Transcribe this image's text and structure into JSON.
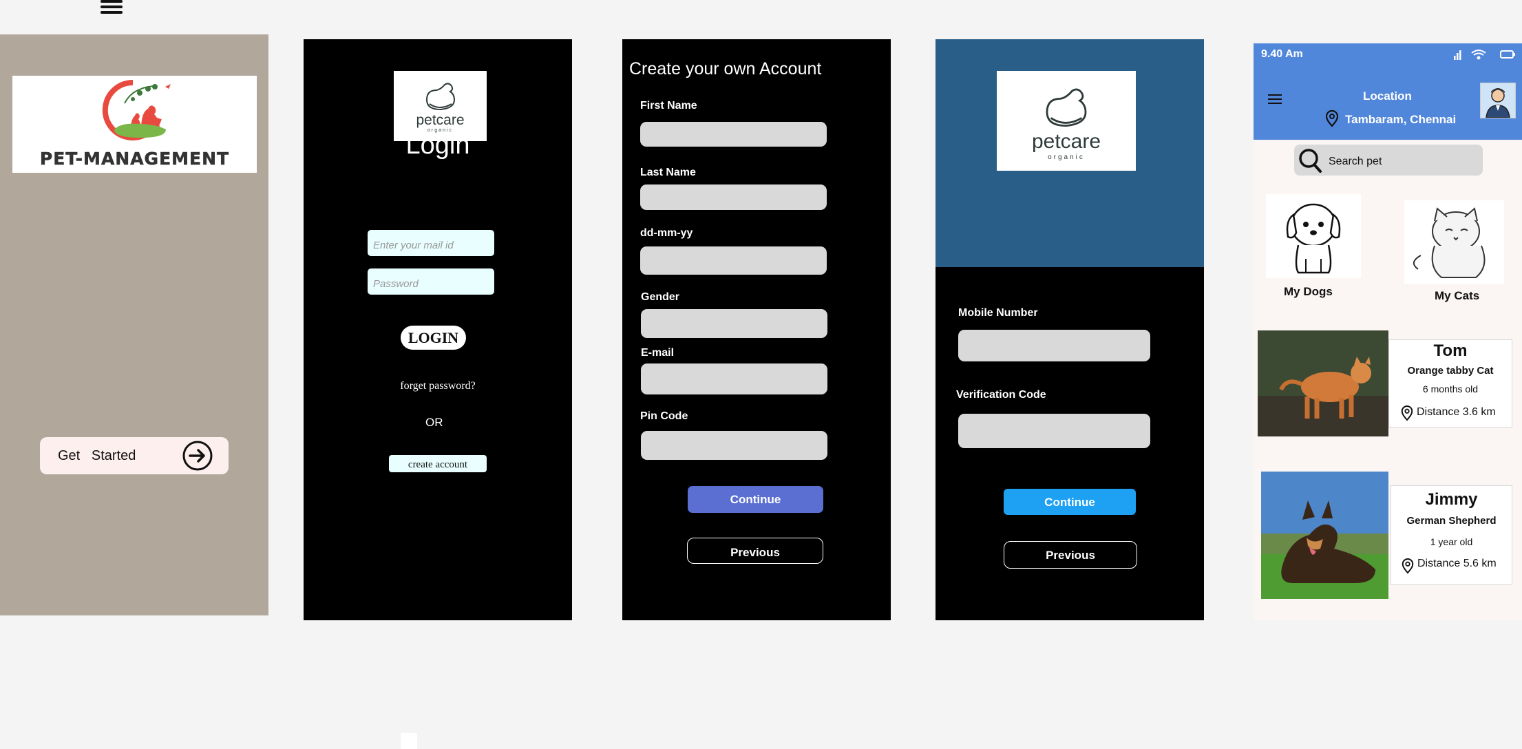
{
  "splash": {
    "logo_text": "PET-MANAGEMENT",
    "get_started_label": "Get   Started"
  },
  "brand": {
    "name": "petcare",
    "tagline": "organic"
  },
  "login": {
    "title": "Login",
    "email_placeholder": "Enter your mail id",
    "password_placeholder": "Password",
    "login_button": "LOGIN",
    "forget_password": "forget password?",
    "or_label": "OR",
    "create_account": "create account"
  },
  "signup": {
    "title": "Create your own Account",
    "fields": {
      "first_name": "First Name",
      "last_name": "Last Name",
      "dob": "dd-mm-yy",
      "gender": "Gender",
      "email": "E-mail",
      "pin_code": "Pin Code"
    },
    "continue": "Continue",
    "previous": "Previous"
  },
  "verify": {
    "mobile_label": "Mobile Number",
    "code_label": "Verification Code",
    "continue": "Continue",
    "previous": "Previous"
  },
  "home": {
    "time": "9.40 Am",
    "location_title": "Location",
    "location_value": "Tambaram, Chennai",
    "search_placeholder": "Search pet",
    "categories": [
      "My Dogs",
      "My Cats"
    ],
    "pets": [
      {
        "name": "Tom",
        "breed": "Orange tabby Cat",
        "age": "6 months old",
        "distance": "Distance 3.6 km"
      },
      {
        "name": "Jimmy",
        "breed": "German Shepherd",
        "age": "1 year old",
        "distance": "Distance 5.6 km"
      }
    ]
  },
  "colors": {
    "splash_bg": "#b1a89b",
    "verify_header": "#285e87",
    "home_header": "#5187db",
    "continue_purple": "#5b6fd2",
    "continue_blue": "#1ea1f3"
  }
}
